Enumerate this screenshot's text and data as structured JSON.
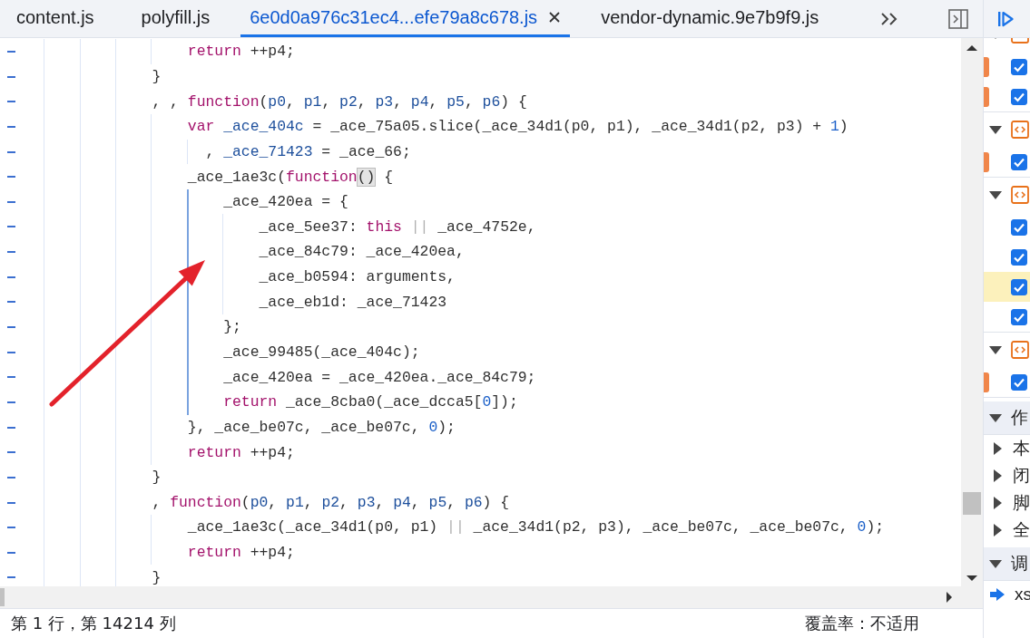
{
  "tabs": [
    {
      "label": "content.js",
      "selected": false,
      "closable": false
    },
    {
      "label": "polyfill.js",
      "selected": false,
      "closable": false
    },
    {
      "label": "6e0d0a976c31ec4...efe79a8c678.js",
      "selected": true,
      "closable": true
    },
    {
      "label": "vendor-dynamic.9e7b9f9.js",
      "selected": false,
      "closable": false
    }
  ],
  "editor": {
    "annotation": {
      "kind": "arrow"
    },
    "lines": [
      {
        "gutter_dash": true,
        "guide_active": false,
        "tokens": [
          {
            "kind": "keyword",
            "text": "                    return"
          },
          {
            "kind": "plain",
            "text": " ++p4;"
          }
        ]
      },
      {
        "gutter_dash": true,
        "guide_active": false,
        "tokens": [
          {
            "kind": "plain",
            "text": "                }"
          }
        ]
      },
      {
        "gutter_dash": true,
        "guide_active": false,
        "tokens": [
          {
            "kind": "plain",
            "text": "                , , "
          },
          {
            "kind": "keyword",
            "text": "function"
          },
          {
            "kind": "plain",
            "text": "("
          },
          {
            "kind": "def",
            "text": "p0"
          },
          {
            "kind": "plain",
            "text": ", "
          },
          {
            "kind": "def",
            "text": "p1"
          },
          {
            "kind": "plain",
            "text": ", "
          },
          {
            "kind": "def",
            "text": "p2"
          },
          {
            "kind": "plain",
            "text": ", "
          },
          {
            "kind": "def",
            "text": "p3"
          },
          {
            "kind": "plain",
            "text": ", "
          },
          {
            "kind": "def",
            "text": "p4"
          },
          {
            "kind": "plain",
            "text": ", "
          },
          {
            "kind": "def",
            "text": "p5"
          },
          {
            "kind": "plain",
            "text": ", "
          },
          {
            "kind": "def",
            "text": "p6"
          },
          {
            "kind": "plain",
            "text": ") {"
          }
        ]
      },
      {
        "gutter_dash": true,
        "guide_active": false,
        "tokens": [
          {
            "kind": "keyword",
            "text": "                    var "
          },
          {
            "kind": "def",
            "text": "_ace_404c"
          },
          {
            "kind": "plain",
            "text": " = _ace_75a05.slice(_ace_34d1(p0, p1), _ace_34d1(p2, p3) + "
          },
          {
            "kind": "number",
            "text": "1"
          },
          {
            "kind": "plain",
            "text": ")"
          }
        ]
      },
      {
        "gutter_dash": true,
        "guide_active": false,
        "tokens": [
          {
            "kind": "plain",
            "text": "                      , "
          },
          {
            "kind": "def",
            "text": "_ace_71423"
          },
          {
            "kind": "plain",
            "text": " = _ace_66;"
          }
        ]
      },
      {
        "gutter_dash": true,
        "guide_active": false,
        "tokens": [
          {
            "kind": "plain",
            "text": "                    _ace_1ae3c("
          },
          {
            "kind": "keyword",
            "text": "function"
          },
          {
            "kind": "match",
            "text": "()"
          },
          {
            "kind": "plain",
            "text": " {"
          }
        ]
      },
      {
        "gutter_dash": true,
        "guide_active": true,
        "tokens": [
          {
            "kind": "plain",
            "text": "                        _ace_420ea = {"
          }
        ]
      },
      {
        "gutter_dash": true,
        "guide_active": true,
        "tokens": [
          {
            "kind": "plain",
            "text": "                            _ace_5ee37: "
          },
          {
            "kind": "keyword",
            "text": "this "
          },
          {
            "kind": "muted",
            "text": "||"
          },
          {
            "kind": "plain",
            "text": " _ace_4752e,"
          }
        ]
      },
      {
        "gutter_dash": true,
        "guide_active": true,
        "tokens": [
          {
            "kind": "plain",
            "text": "                            _ace_84c79: _ace_420ea,"
          }
        ]
      },
      {
        "gutter_dash": true,
        "guide_active": true,
        "tokens": [
          {
            "kind": "plain",
            "text": "                            _ace_b0594: arguments,"
          }
        ]
      },
      {
        "gutter_dash": true,
        "guide_active": true,
        "tokens": [
          {
            "kind": "plain",
            "text": "                            _ace_eb1d: _ace_71423"
          }
        ]
      },
      {
        "gutter_dash": true,
        "guide_active": true,
        "tokens": [
          {
            "kind": "plain",
            "text": "                        };"
          }
        ]
      },
      {
        "gutter_dash": true,
        "guide_active": true,
        "tokens": [
          {
            "kind": "plain",
            "text": "                        _ace_99485(_ace_404c);"
          }
        ]
      },
      {
        "gutter_dash": true,
        "guide_active": true,
        "tokens": [
          {
            "kind": "plain",
            "text": "                        _ace_420ea = _ace_420ea._ace_84c79;"
          }
        ]
      },
      {
        "gutter_dash": true,
        "guide_active": true,
        "tokens": [
          {
            "kind": "keyword",
            "text": "                        return"
          },
          {
            "kind": "plain",
            "text": " _ace_8cba0(_ace_dcca5["
          },
          {
            "kind": "number",
            "text": "0"
          },
          {
            "kind": "plain",
            "text": "]);"
          }
        ]
      },
      {
        "gutter_dash": true,
        "guide_active": false,
        "tokens": [
          {
            "kind": "plain",
            "text": "                    }, _ace_be07c, _ace_be07c, "
          },
          {
            "kind": "number",
            "text": "0"
          },
          {
            "kind": "plain",
            "text": ");"
          }
        ]
      },
      {
        "gutter_dash": true,
        "guide_active": false,
        "tokens": [
          {
            "kind": "keyword",
            "text": "                    return"
          },
          {
            "kind": "plain",
            "text": " ++p4;"
          }
        ]
      },
      {
        "gutter_dash": true,
        "guide_active": false,
        "tokens": [
          {
            "kind": "plain",
            "text": "                }"
          }
        ]
      },
      {
        "gutter_dash": true,
        "guide_active": false,
        "tokens": [
          {
            "kind": "plain",
            "text": "                , "
          },
          {
            "kind": "keyword",
            "text": "function"
          },
          {
            "kind": "plain",
            "text": "("
          },
          {
            "kind": "def",
            "text": "p0"
          },
          {
            "kind": "plain",
            "text": ", "
          },
          {
            "kind": "def",
            "text": "p1"
          },
          {
            "kind": "plain",
            "text": ", "
          },
          {
            "kind": "def",
            "text": "p2"
          },
          {
            "kind": "plain",
            "text": ", "
          },
          {
            "kind": "def",
            "text": "p3"
          },
          {
            "kind": "plain",
            "text": ", "
          },
          {
            "kind": "def",
            "text": "p4"
          },
          {
            "kind": "plain",
            "text": ", "
          },
          {
            "kind": "def",
            "text": "p5"
          },
          {
            "kind": "plain",
            "text": ", "
          },
          {
            "kind": "def",
            "text": "p6"
          },
          {
            "kind": "plain",
            "text": ") {"
          }
        ]
      },
      {
        "gutter_dash": true,
        "guide_active": false,
        "tokens": [
          {
            "kind": "plain",
            "text": "                    _ace_1ae3c(_ace_34d1(p0, p1) "
          },
          {
            "kind": "muted",
            "text": "||"
          },
          {
            "kind": "plain",
            "text": " _ace_34d1(p2, p3), _ace_be07c, _ace_be07c, "
          },
          {
            "kind": "number",
            "text": "0"
          },
          {
            "kind": "plain",
            "text": ");"
          }
        ]
      },
      {
        "gutter_dash": true,
        "guide_active": false,
        "tokens": [
          {
            "kind": "keyword",
            "text": "                    return"
          },
          {
            "kind": "plain",
            "text": " ++p4;"
          }
        ]
      },
      {
        "gutter_dash": true,
        "guide_active": false,
        "tokens": [
          {
            "kind": "plain",
            "text": "                }"
          }
        ]
      }
    ]
  },
  "status_bar": {
    "position": "第 1 行，第 14214 列",
    "coverage": "覆盖率：不适用"
  },
  "breakpoint_groups": [
    {
      "expanded": true,
      "breakpoints": [
        {
          "checked": true,
          "marked": true,
          "highlighted": false
        },
        {
          "checked": true,
          "marked": true,
          "highlighted": false
        }
      ]
    },
    {
      "expanded": true,
      "breakpoints": [
        {
          "checked": true,
          "marked": true,
          "highlighted": false
        }
      ]
    },
    {
      "expanded": true,
      "breakpoints": [
        {
          "checked": true,
          "marked": false,
          "highlighted": false
        },
        {
          "checked": true,
          "marked": false,
          "highlighted": false
        },
        {
          "checked": true,
          "marked": false,
          "highlighted": true
        },
        {
          "checked": true,
          "marked": false,
          "highlighted": false
        }
      ]
    },
    {
      "expanded": true,
      "breakpoints": [
        {
          "checked": true,
          "marked": true,
          "highlighted": false
        }
      ]
    }
  ],
  "sections": [
    {
      "title": "作",
      "expanded": true,
      "items": [
        {
          "label": "本",
          "expanded": false,
          "current": false
        },
        {
          "label": "闭",
          "expanded": false,
          "current": false
        },
        {
          "label": "脚",
          "expanded": false,
          "current": false
        },
        {
          "label": "全",
          "expanded": false,
          "current": false
        }
      ]
    },
    {
      "title": "调",
      "expanded": true,
      "items": [
        {
          "label": "xs",
          "current": true
        }
      ]
    }
  ]
}
